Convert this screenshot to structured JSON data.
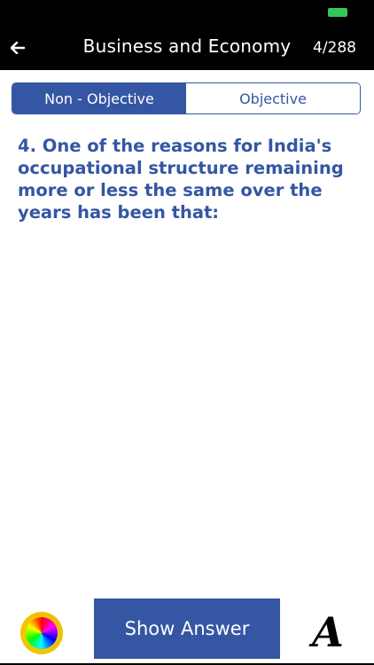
{
  "nav": {
    "title": "Business and Economy",
    "counter": "4/288"
  },
  "tabs": [
    {
      "label": "Non - Objective",
      "active": true
    },
    {
      "label": "Objective",
      "active": false
    }
  ],
  "question": {
    "text": "4. One of the reasons for India's occupational structure remaining more or less the same over the years has been that:"
  },
  "footer": {
    "show_answer_label": "Show Answer",
    "font_button_label": "A"
  },
  "colors": {
    "accent": "#3456a3",
    "battery": "#33c75a"
  },
  "icons": {
    "back": "back-arrow-icon",
    "theme": "color-wheel-icon",
    "font": "font-size-icon",
    "battery": "battery-icon"
  }
}
